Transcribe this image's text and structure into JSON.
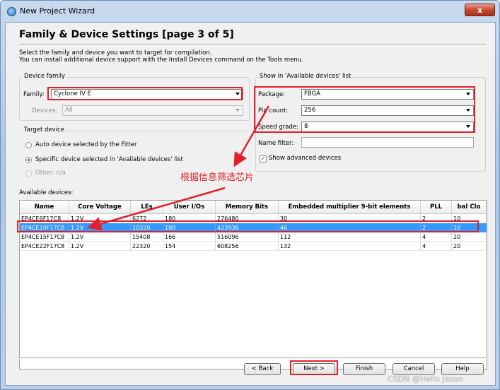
{
  "window": {
    "title": "New Project Wizard",
    "close_label": "x"
  },
  "page": {
    "heading": "Family & Device Settings [page 3 of 5]",
    "description_line1": "Select the family and device you want to target for compilation.",
    "description_line2": "You can install additional device support with the Install Devices command on the Tools menu."
  },
  "device_family": {
    "group_title": "Device family",
    "family_label": "Family:",
    "family_value": "Cyclone IV E",
    "devices_label": "Devices:",
    "devices_value": "All"
  },
  "target_device": {
    "group_title": "Target device",
    "options": [
      {
        "label": "Auto device selected by the Fitter",
        "selected": false,
        "enabled": true
      },
      {
        "label": "Specific device selected in 'Available devices' list",
        "selected": true,
        "enabled": true
      },
      {
        "label": "Other:  n/a",
        "selected": false,
        "enabled": false
      }
    ]
  },
  "filters": {
    "group_title": "Show in 'Available devices' list",
    "package_label": "Package:",
    "package_value": "FBGA",
    "pin_count_label": "Pin count:",
    "pin_count_value": "256",
    "speed_grade_label": "Speed grade:",
    "speed_grade_value": "8",
    "name_filter_label": "Name filter:",
    "name_filter_value": "",
    "show_advanced_label": "Show advanced devices",
    "show_advanced_checked": true
  },
  "available_devices": {
    "label": "Available devices:",
    "columns": [
      "Name",
      "Core Voltage",
      "LEs",
      "User I/Os",
      "Memory Bits",
      "Embedded multiplier 9-bit elements",
      "PLL",
      "bal Clo"
    ],
    "rows": [
      [
        "EP4CE6F17C8",
        "1.2V",
        "6272",
        "180",
        "276480",
        "30",
        "2",
        "10"
      ],
      [
        "EP4CE10F17C8",
        "1.2V",
        "10320",
        "180",
        "423936",
        "46",
        "2",
        "10"
      ],
      [
        "EP4CE15F17C8",
        "1.2V",
        "15408",
        "166",
        "516096",
        "112",
        "4",
        "20"
      ],
      [
        "EP4CE22F17C8",
        "1.2V",
        "22320",
        "154",
        "608256",
        "132",
        "4",
        "20"
      ]
    ],
    "selected_row": 1
  },
  "buttons": {
    "back": "< Back",
    "next": "Next >",
    "finish": "Finish",
    "cancel": "Cancel",
    "help": "Help"
  },
  "annotation": {
    "text": "根据信息筛选芯片",
    "color": "#e0202a"
  },
  "watermark": "CSDN @Hello Jason"
}
